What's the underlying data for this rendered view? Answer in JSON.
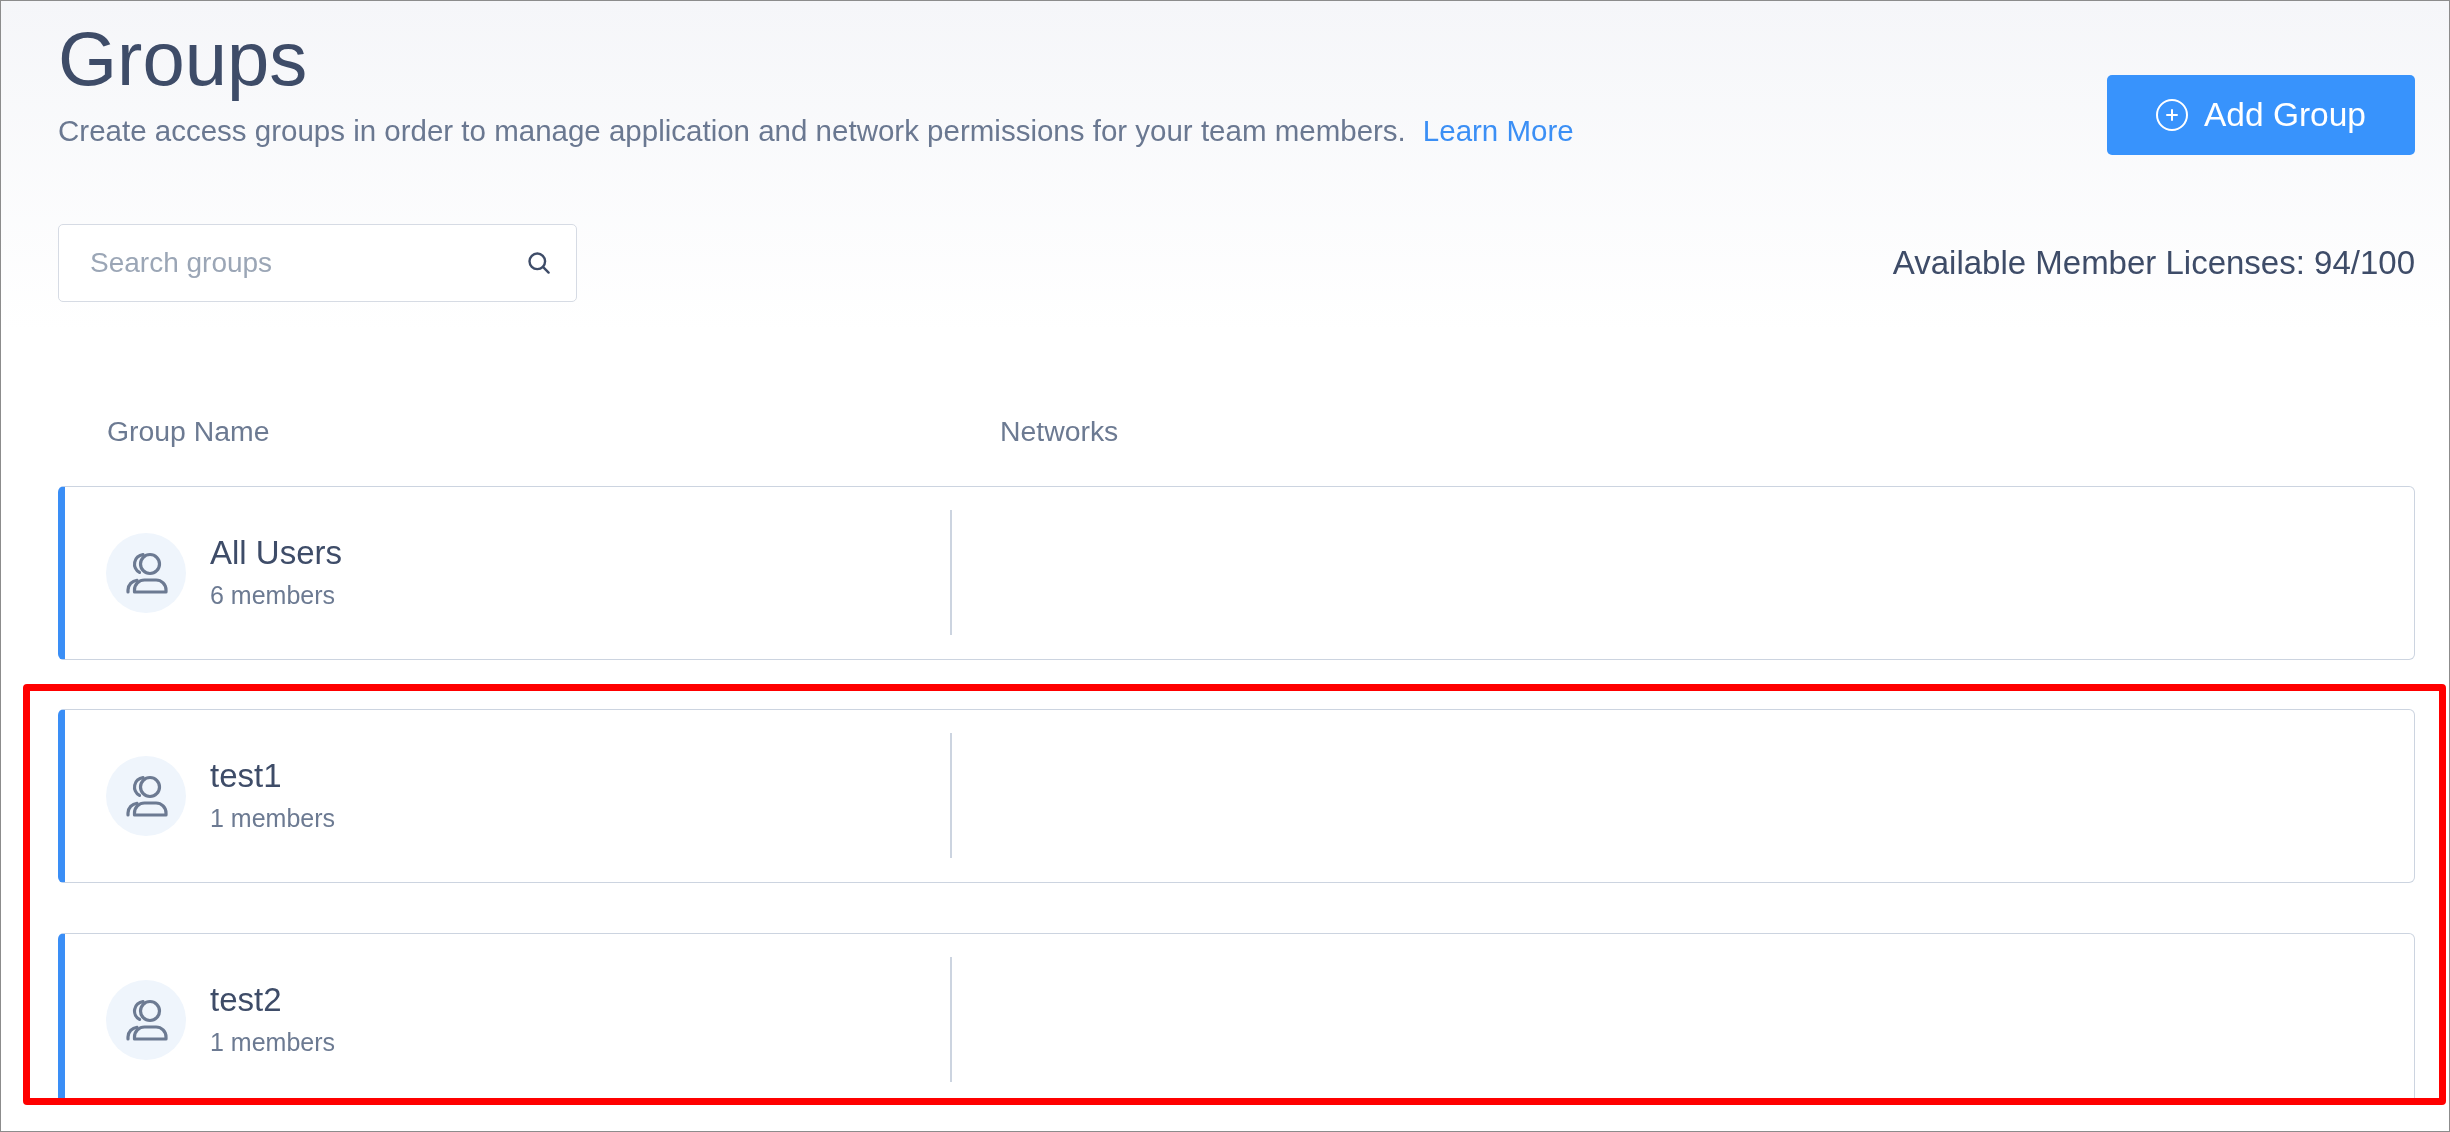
{
  "page": {
    "title": "Groups",
    "description": "Create access groups in order to manage application and network permissions for your team members.",
    "learn_more_link": "Learn More"
  },
  "add_button": {
    "label": "Add Group"
  },
  "search": {
    "placeholder": "Search groups"
  },
  "licenses": "Available Member Licenses: 94/100",
  "table": {
    "columns": [
      "Group Name",
      "Networks"
    ],
    "rows": [
      {
        "name": "All Users",
        "members": "6 members",
        "highlighted": false
      },
      {
        "name": "test1",
        "members": "1 members",
        "highlighted": true
      },
      {
        "name": "test2",
        "members": "1 members",
        "highlighted": true
      }
    ]
  }
}
